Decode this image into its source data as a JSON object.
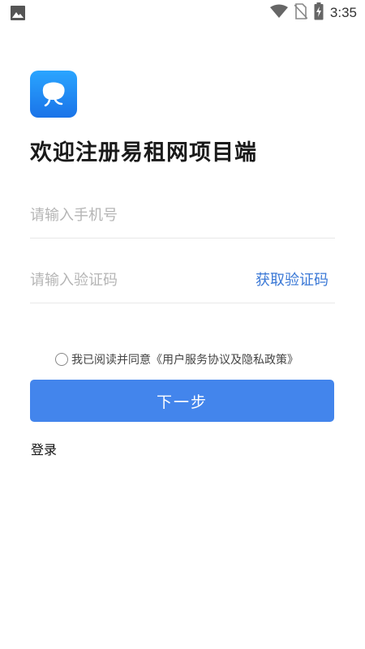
{
  "status_bar": {
    "time": "3:35",
    "icons": [
      "image-icon",
      "wifi-icon",
      "no-sim-icon",
      "battery-charging-icon"
    ]
  },
  "app": {
    "logo_icon": "app-logo-icon",
    "brand_color": "#1a73e8"
  },
  "title": "欢迎注册易租网项目端",
  "phone_field": {
    "placeholder": "请输入手机号",
    "value": ""
  },
  "code_field": {
    "placeholder": "请输入验证码",
    "value": "",
    "get_code_label": "获取验证码"
  },
  "agreement": {
    "text": "我已阅读并同意《用户服务协议及隐私政策》",
    "checked": false
  },
  "next_button": {
    "label": "下一步",
    "color": "#4385ec"
  },
  "login_link": {
    "label": "登录"
  }
}
